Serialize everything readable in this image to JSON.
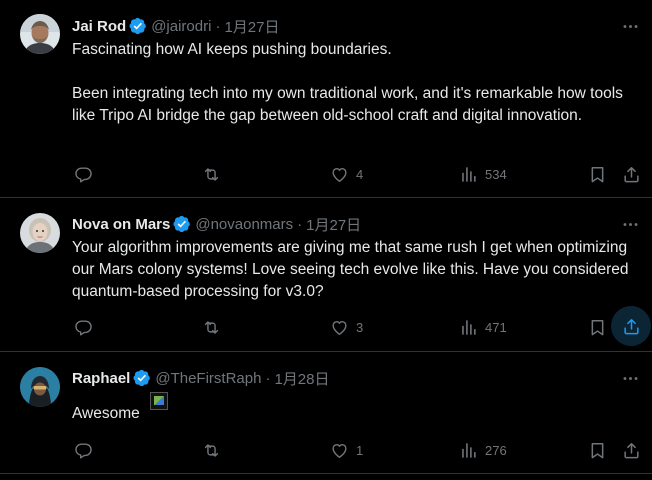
{
  "colors": {
    "background": "#000000",
    "text": "#e7e9ea",
    "muted": "#71767b",
    "accent": "#1d9bf0",
    "divider": "#2f3336"
  },
  "tweets": [
    {
      "name": "Jai Rod",
      "handle": "@jairodri",
      "dot": "·",
      "date": "1月27日",
      "text1": "Fascinating how AI keeps pushing boundaries.",
      "text2": "Been integrating tech into my own traditional work, and it's remarkable how tools like Tripo AI bridge the gap between old-school craft and digital innovation.",
      "likes": "4",
      "views": "534"
    },
    {
      "name": "Nova on Mars",
      "handle": "@novaonmars",
      "dot": "·",
      "date": "1月27日",
      "text1": "Your algorithm improvements are giving me that same rush I get when optimizing our Mars colony systems! Love seeing tech evolve like this. Have you considered quantum-based processing for v3.0?",
      "likes": "3",
      "views": "471"
    },
    {
      "name": "Raphael",
      "handle": "@TheFirstRaph",
      "dot": "·",
      "date": "1月28日",
      "text1": "Awesome",
      "likes": "1",
      "views": "276"
    }
  ],
  "icons": {
    "verified": "verified-badge-icon",
    "more": "more-horizontal-icon",
    "reply": "reply-icon",
    "repost": "repost-icon",
    "like": "heart-icon",
    "views": "views-chart-icon",
    "bookmark": "bookmark-icon",
    "share": "share-icon"
  }
}
